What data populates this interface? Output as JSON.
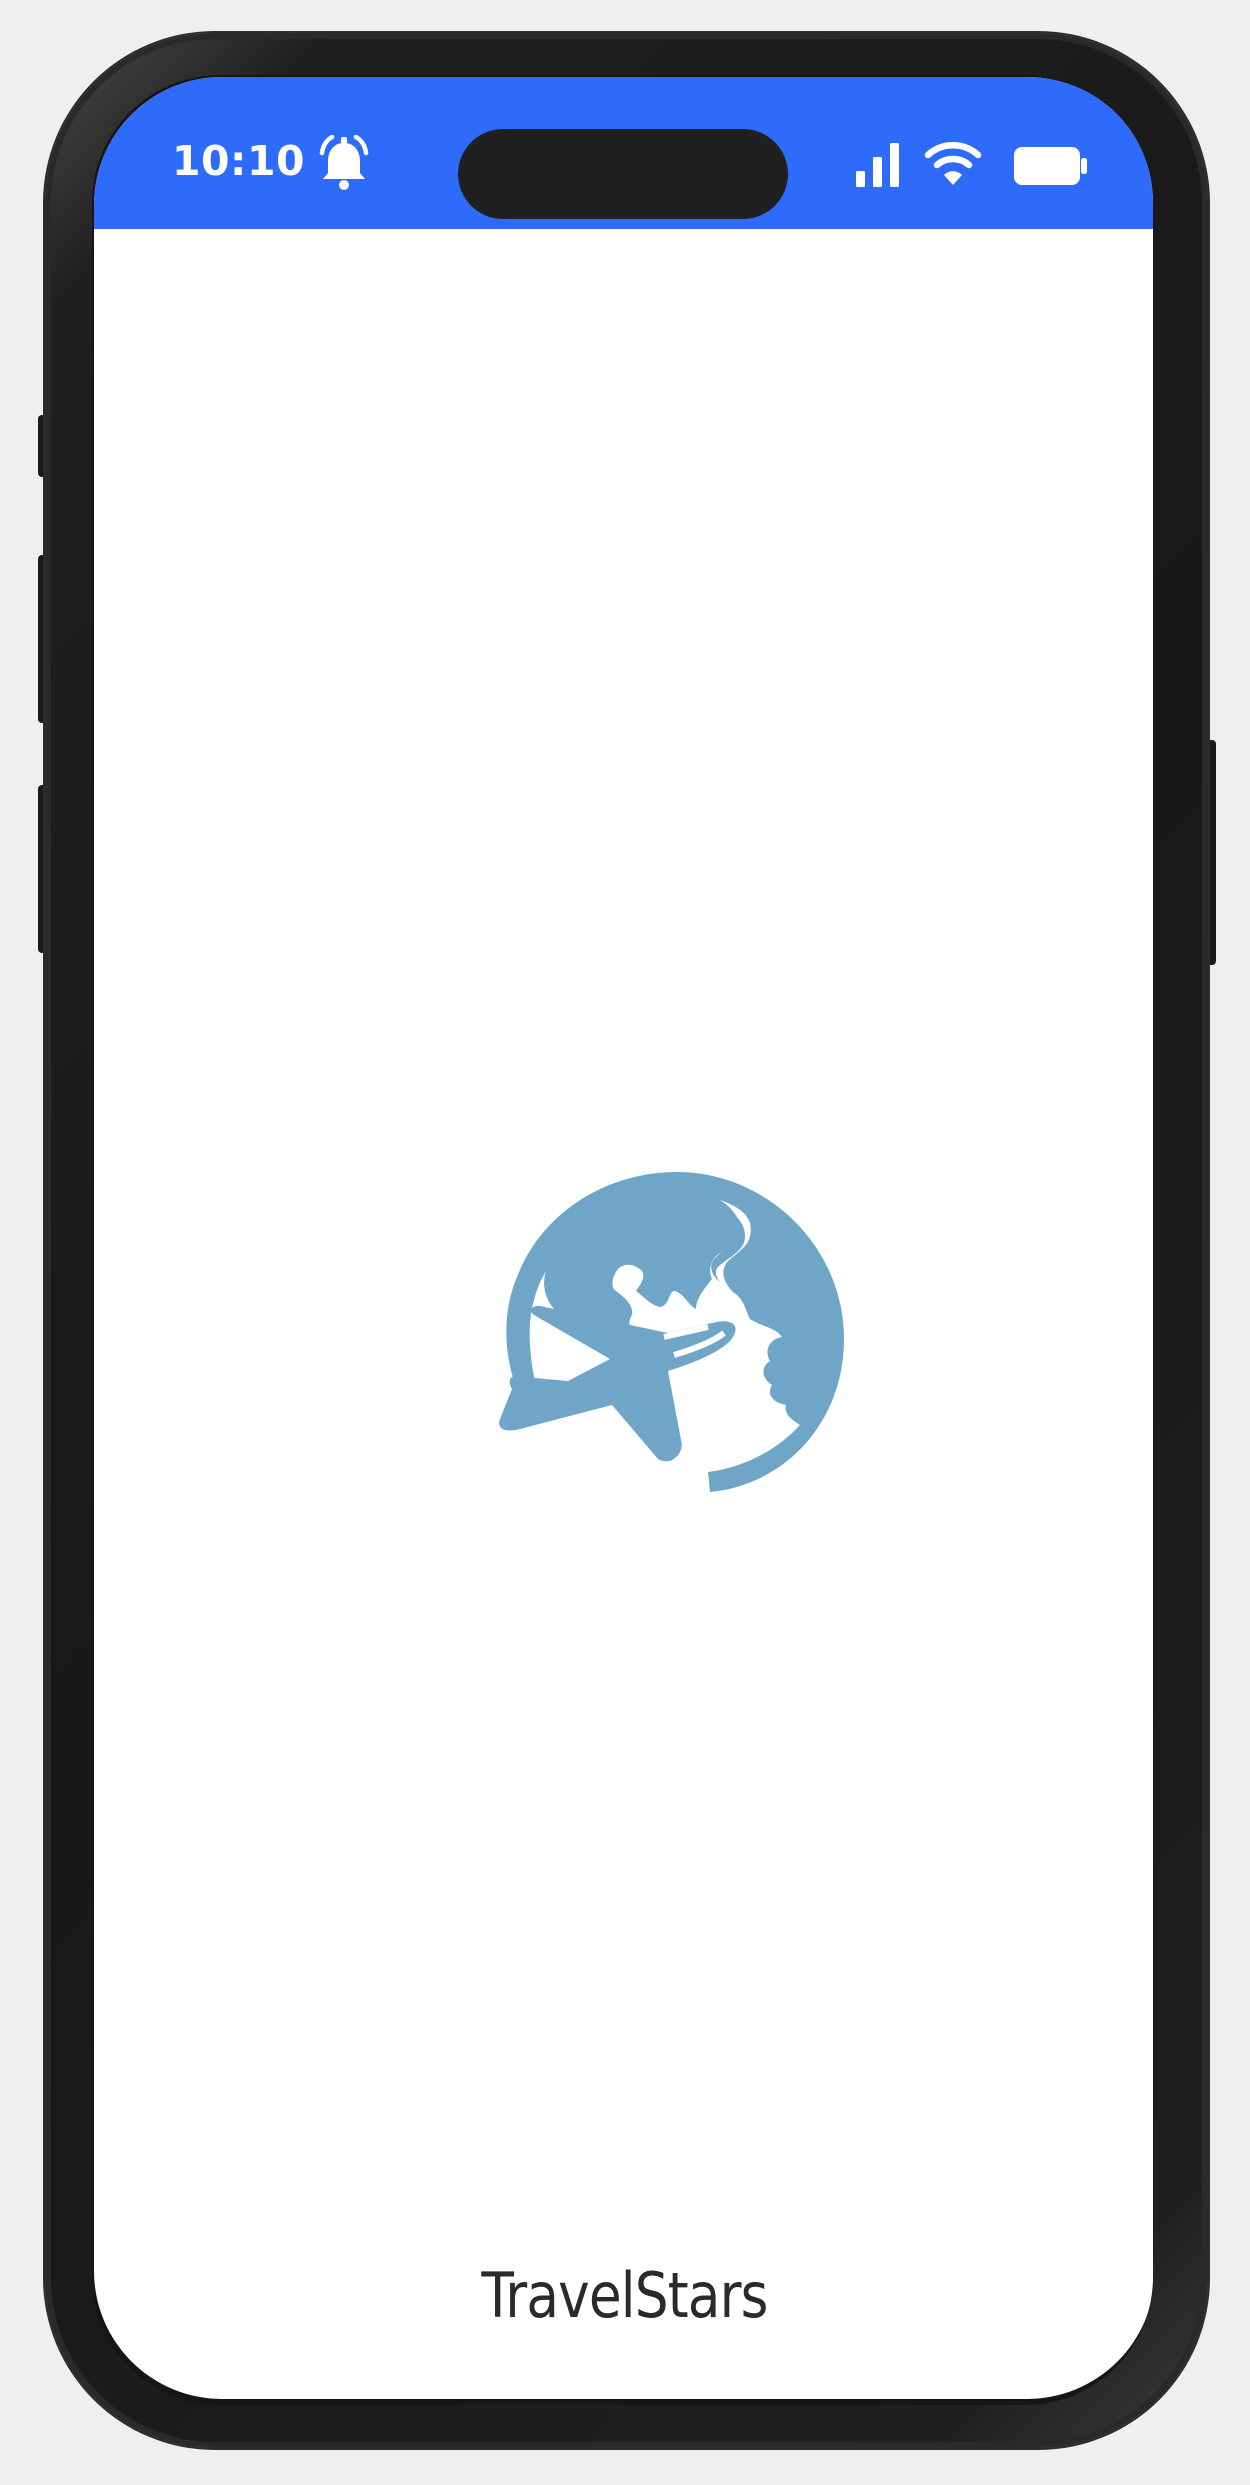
{
  "status_bar": {
    "time": "10:10",
    "background_color": "#2f6bfb",
    "icons": [
      "alarm-icon",
      "cellular-signal-icon",
      "wifi-icon",
      "battery-icon"
    ]
  },
  "splash": {
    "logo_icon": "globe-airplane-icon",
    "logo_color": "#6fa6c8",
    "app_name": "TravelStars"
  }
}
